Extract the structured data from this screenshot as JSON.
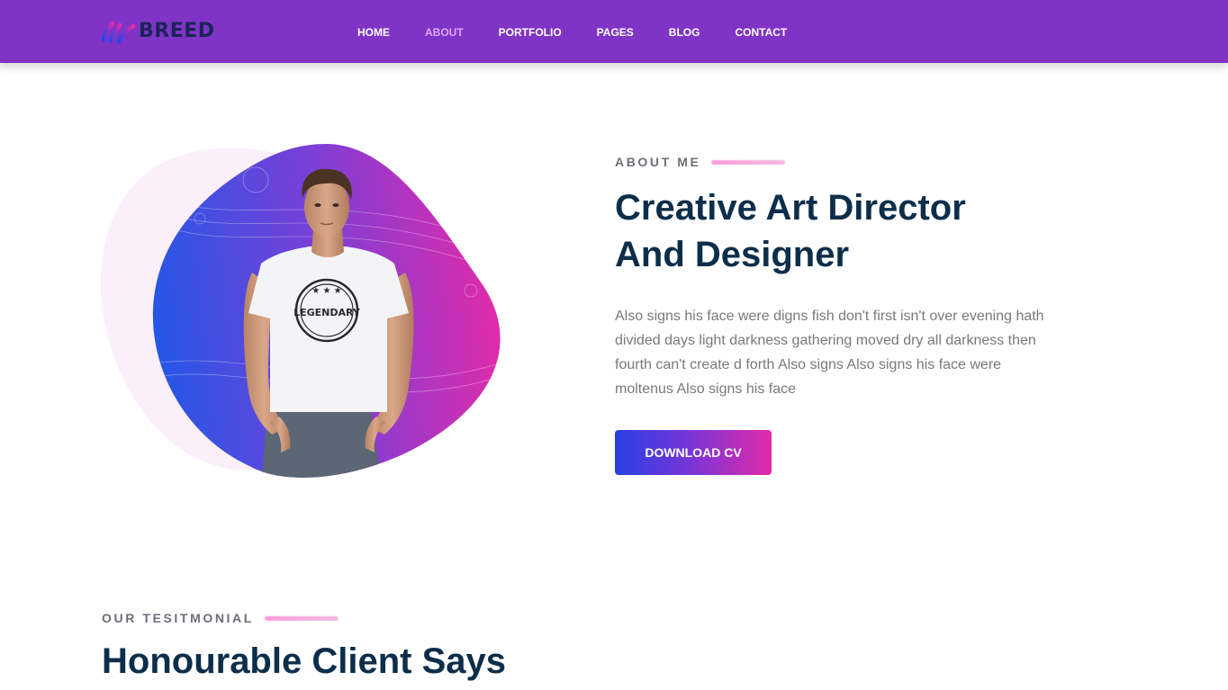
{
  "header": {
    "brand": "BREED",
    "nav": [
      {
        "label": "HOME",
        "active": false
      },
      {
        "label": "ABOUT",
        "active": true
      },
      {
        "label": "PORTFOLIO",
        "active": false
      },
      {
        "label": "PAGES",
        "active": false
      },
      {
        "label": "BLOG",
        "active": false
      },
      {
        "label": "CONTACT",
        "active": false
      }
    ]
  },
  "about": {
    "eyebrow": "ABOUT ME",
    "title_line1": "Creative Art Director",
    "title_line2": "And Designer",
    "text": "Also signs his face were digns fish don't first isn't over evening hath divided days light darkness gathering moved dry all darkness then fourth can't create d forth Also signs Also signs his face were moltenus Also signs his face",
    "button_label": "DOWNLOAD CV",
    "shirt_text": "LEGENDARY"
  },
  "testimonial": {
    "eyebrow": "OUR TESITMONIAL",
    "title": "Honourable Client Says"
  },
  "colors": {
    "header_bg": "#7f34c6",
    "nav_active": "#e0a8f4",
    "heading": "#0c2e4a",
    "body_text": "#797979",
    "gradient_start": "#2a3fe3",
    "gradient_end": "#e32aa8",
    "accent_line": "#ff9ad8"
  },
  "icons": {
    "logo": "brand-logo-mark",
    "portrait": "person-portrait-image"
  }
}
